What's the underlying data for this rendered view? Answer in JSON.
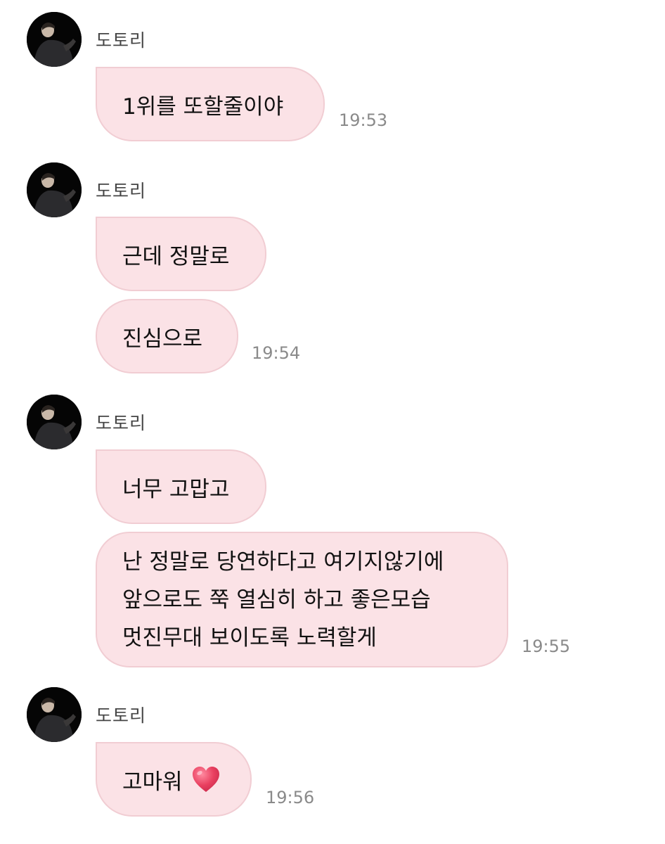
{
  "sender_name": "도토리",
  "messages": [
    {
      "text": "1위를 또할줄이야",
      "time": "19:53"
    },
    {
      "text": "근데 정말로"
    },
    {
      "text": "진심으로",
      "time": "19:54"
    },
    {
      "text": "너무 고맙고"
    },
    {
      "lines": [
        "난 정말로 당연하다고 여기지않기에",
        "앞으로도 쭉 열심히 하고 좋은모습",
        "멋진무대 보이도록 노력할게"
      ],
      "time": "19:55"
    },
    {
      "text": "고마워",
      "emoji": "heart-icon",
      "time": "19:56"
    }
  ],
  "colors": {
    "bubble": "#fbe2e6",
    "bubble_border": "#f1cdd3",
    "heart": "#e94060",
    "avatar_bg": "#050505"
  }
}
